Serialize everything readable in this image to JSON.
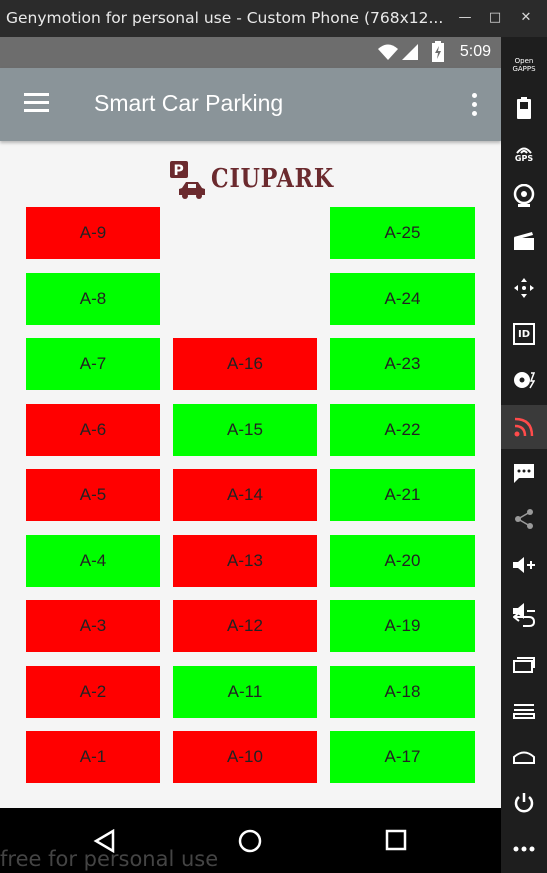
{
  "window": {
    "title": "Genymotion for personal use - Custom Phone (768x12...",
    "min_icon": "minimize-icon",
    "max_icon": "maximize-icon",
    "close_icon": "close-icon"
  },
  "status_bar": {
    "time": "5:09",
    "icons": [
      "wifi-icon",
      "signal-icon",
      "battery-icon"
    ]
  },
  "app_bar": {
    "title": "Smart Car Parking",
    "menu_icon": "hamburger-menu-icon",
    "overflow_icon": "overflow-menu-icon"
  },
  "logo": {
    "text": "CIUPARK",
    "icon": "parking-car-icon",
    "color": "#6b2a2e"
  },
  "colors": {
    "occupied": "#ff0000",
    "free": "#00ff00",
    "app_bar": "#8a9499"
  },
  "parking": {
    "columns": [
      [
        {
          "label": "A-9",
          "status": "occupied"
        },
        {
          "label": "A-8",
          "status": "free"
        },
        {
          "label": "A-7",
          "status": "free"
        },
        {
          "label": "A-6",
          "status": "occupied"
        },
        {
          "label": "A-5",
          "status": "occupied"
        },
        {
          "label": "A-4",
          "status": "free"
        },
        {
          "label": "A-3",
          "status": "occupied"
        },
        {
          "label": "A-2",
          "status": "occupied"
        },
        {
          "label": "A-1",
          "status": "occupied"
        }
      ],
      [
        {
          "label": "A-16",
          "status": "occupied"
        },
        {
          "label": "A-15",
          "status": "free"
        },
        {
          "label": "A-14",
          "status": "occupied"
        },
        {
          "label": "A-13",
          "status": "occupied"
        },
        {
          "label": "A-12",
          "status": "occupied"
        },
        {
          "label": "A-11",
          "status": "free"
        },
        {
          "label": "A-10",
          "status": "occupied"
        }
      ],
      [
        {
          "label": "A-25",
          "status": "free"
        },
        {
          "label": "A-24",
          "status": "free"
        },
        {
          "label": "A-23",
          "status": "free"
        },
        {
          "label": "A-22",
          "status": "free"
        },
        {
          "label": "A-21",
          "status": "free"
        },
        {
          "label": "A-20",
          "status": "free"
        },
        {
          "label": "A-19",
          "status": "free"
        },
        {
          "label": "A-18",
          "status": "free"
        },
        {
          "label": "A-17",
          "status": "free"
        }
      ]
    ]
  },
  "nav_bar": {
    "back_icon": "back-icon",
    "home_icon": "home-icon",
    "recents_icon": "recents-icon"
  },
  "watermark": "free for personal use",
  "sidebar": {
    "items": [
      {
        "name": "opengapps-icon",
        "label": "Open GAPPS"
      },
      {
        "name": "battery-widget-icon"
      },
      {
        "name": "gps-icon",
        "label": "GPS"
      },
      {
        "name": "webcam-icon"
      },
      {
        "name": "capture-icon"
      },
      {
        "name": "dpad-icon"
      },
      {
        "name": "device-id-icon",
        "label": "ID"
      },
      {
        "name": "disk-io-icon"
      },
      {
        "name": "network-icon"
      },
      {
        "name": "sms-icon"
      },
      {
        "name": "share-icon"
      },
      {
        "name": "volume-up-icon"
      },
      {
        "name": "volume-down-icon"
      },
      {
        "name": "back-icon"
      },
      {
        "name": "recent-apps-icon"
      },
      {
        "name": "menu-icon"
      },
      {
        "name": "home-icon"
      },
      {
        "name": "power-icon"
      },
      {
        "name": "more-icon"
      }
    ]
  }
}
